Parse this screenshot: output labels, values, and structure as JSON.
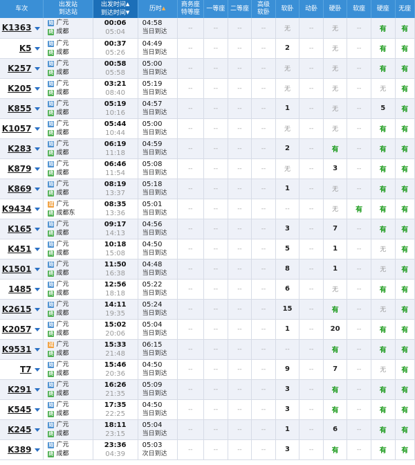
{
  "headers": {
    "train": "车次",
    "stations_top": "出发站",
    "stations_bottom": "到达站",
    "times_top": "出发时间",
    "times_bottom": "到达时间",
    "duration": "历时",
    "business_top": "商务座",
    "business_bottom": "特等座",
    "first": "一等座",
    "second": "二等座",
    "advsleeper_top": "高级",
    "advsleeper_bottom": "软卧",
    "softsleeper": "软卧",
    "emu": "动卧",
    "hardsleeper": "硬卧",
    "softseat": "软座",
    "hardseat": "硬座",
    "noseat": "无座",
    "sort_arrow": "▲"
  },
  "trains": [
    {
      "no": "K1363",
      "from": "广元",
      "to": "成都",
      "from_type": "始",
      "to_type": "终",
      "dep": "00:06",
      "arr": "05:04",
      "dur": "04:58",
      "day": "当日到达",
      "seats": [
        "--",
        "--",
        "--",
        "--",
        "无",
        "--",
        "无",
        "--",
        "有",
        "有"
      ]
    },
    {
      "no": "K5",
      "from": "广元",
      "to": "成都",
      "from_type": "始",
      "to_type": "终",
      "dep": "00:37",
      "arr": "05:26",
      "dur": "04:49",
      "day": "当日到达",
      "seats": [
        "--",
        "--",
        "--",
        "--",
        "2",
        "--",
        "无",
        "--",
        "有",
        "有"
      ]
    },
    {
      "no": "K257",
      "from": "广元",
      "to": "成都",
      "from_type": "始",
      "to_type": "终",
      "dep": "00:58",
      "arr": "05:58",
      "dur": "05:00",
      "day": "当日到达",
      "seats": [
        "--",
        "--",
        "--",
        "--",
        "无",
        "--",
        "无",
        "--",
        "有",
        "有"
      ]
    },
    {
      "no": "K205",
      "from": "广元",
      "to": "成都",
      "from_type": "始",
      "to_type": "终",
      "dep": "03:21",
      "arr": "08:40",
      "dur": "05:19",
      "day": "当日到达",
      "seats": [
        "--",
        "--",
        "--",
        "--",
        "无",
        "--",
        "无",
        "--",
        "无",
        "有"
      ]
    },
    {
      "no": "K855",
      "from": "广元",
      "to": "成都",
      "from_type": "始",
      "to_type": "终",
      "dep": "05:19",
      "arr": "10:16",
      "dur": "04:57",
      "day": "当日到达",
      "seats": [
        "--",
        "--",
        "--",
        "--",
        "1",
        "--",
        "无",
        "--",
        "5",
        "有"
      ]
    },
    {
      "no": "K1057",
      "from": "广元",
      "to": "成都",
      "from_type": "始",
      "to_type": "终",
      "dep": "05:44",
      "arr": "10:44",
      "dur": "05:00",
      "day": "当日到达",
      "seats": [
        "--",
        "--",
        "--",
        "--",
        "无",
        "--",
        "无",
        "--",
        "有",
        "有"
      ]
    },
    {
      "no": "K283",
      "from": "广元",
      "to": "成都",
      "from_type": "始",
      "to_type": "终",
      "dep": "06:19",
      "arr": "11:18",
      "dur": "04:59",
      "day": "当日到达",
      "seats": [
        "--",
        "--",
        "--",
        "--",
        "2",
        "--",
        "有",
        "--",
        "有",
        "有"
      ]
    },
    {
      "no": "K879",
      "from": "广元",
      "to": "成都",
      "from_type": "始",
      "to_type": "终",
      "dep": "06:46",
      "arr": "11:54",
      "dur": "05:08",
      "day": "当日到达",
      "seats": [
        "--",
        "--",
        "--",
        "--",
        "无",
        "--",
        "3",
        "--",
        "有",
        "有"
      ]
    },
    {
      "no": "K869",
      "from": "广元",
      "to": "成都",
      "from_type": "始",
      "to_type": "终",
      "dep": "08:19",
      "arr": "13:37",
      "dur": "05:18",
      "day": "当日到达",
      "seats": [
        "--",
        "--",
        "--",
        "--",
        "1",
        "--",
        "无",
        "--",
        "有",
        "有"
      ]
    },
    {
      "no": "K9434",
      "from": "广元",
      "to": "成都东",
      "from_type": "过",
      "to_type": "终",
      "dep": "08:35",
      "arr": "13:36",
      "dur": "05:01",
      "day": "当日到达",
      "seats": [
        "--",
        "--",
        "--",
        "--",
        "--",
        "--",
        "无",
        "有",
        "有",
        "有"
      ]
    },
    {
      "no": "K165",
      "from": "广元",
      "to": "成都",
      "from_type": "始",
      "to_type": "终",
      "dep": "09:17",
      "arr": "14:13",
      "dur": "04:56",
      "day": "当日到达",
      "seats": [
        "--",
        "--",
        "--",
        "--",
        "3",
        "--",
        "7",
        "--",
        "有",
        "有"
      ]
    },
    {
      "no": "K451",
      "from": "广元",
      "to": "成都",
      "from_type": "始",
      "to_type": "终",
      "dep": "10:18",
      "arr": "15:08",
      "dur": "04:50",
      "day": "当日到达",
      "seats": [
        "--",
        "--",
        "--",
        "--",
        "5",
        "--",
        "1",
        "--",
        "无",
        "有"
      ]
    },
    {
      "no": "K1501",
      "from": "广元",
      "to": "成都",
      "from_type": "始",
      "to_type": "终",
      "dep": "11:50",
      "arr": "16:38",
      "dur": "04:48",
      "day": "当日到达",
      "seats": [
        "--",
        "--",
        "--",
        "--",
        "8",
        "--",
        "1",
        "--",
        "无",
        "有"
      ]
    },
    {
      "no": "1485",
      "from": "广元",
      "to": "成都",
      "from_type": "始",
      "to_type": "终",
      "dep": "12:56",
      "arr": "18:18",
      "dur": "05:22",
      "day": "当日到达",
      "seats": [
        "--",
        "--",
        "--",
        "--",
        "6",
        "--",
        "无",
        "--",
        "有",
        "有"
      ]
    },
    {
      "no": "K2615",
      "from": "广元",
      "to": "成都",
      "from_type": "始",
      "to_type": "终",
      "dep": "14:11",
      "arr": "19:35",
      "dur": "05:24",
      "day": "当日到达",
      "seats": [
        "--",
        "--",
        "--",
        "--",
        "15",
        "--",
        "有",
        "--",
        "无",
        "有"
      ]
    },
    {
      "no": "K2057",
      "from": "广元",
      "to": "成都",
      "from_type": "始",
      "to_type": "终",
      "dep": "15:02",
      "arr": "20:06",
      "dur": "05:04",
      "day": "当日到达",
      "seats": [
        "--",
        "--",
        "--",
        "--",
        "1",
        "--",
        "20",
        "--",
        "有",
        "有"
      ]
    },
    {
      "no": "K9531",
      "from": "广元",
      "to": "成都",
      "from_type": "过",
      "to_type": "终",
      "dep": "15:33",
      "arr": "21:48",
      "dur": "06:15",
      "day": "当日到达",
      "seats": [
        "--",
        "--",
        "--",
        "--",
        "--",
        "--",
        "有",
        "--",
        "有",
        "有"
      ]
    },
    {
      "no": "T7",
      "from": "广元",
      "to": "成都",
      "from_type": "始",
      "to_type": "终",
      "dep": "15:46",
      "arr": "20:36",
      "dur": "04:50",
      "day": "当日到达",
      "seats": [
        "--",
        "--",
        "--",
        "--",
        "9",
        "--",
        "7",
        "--",
        "无",
        "有"
      ]
    },
    {
      "no": "K291",
      "from": "广元",
      "to": "成都",
      "from_type": "始",
      "to_type": "终",
      "dep": "16:26",
      "arr": "21:35",
      "dur": "05:09",
      "day": "当日到达",
      "seats": [
        "--",
        "--",
        "--",
        "--",
        "3",
        "--",
        "有",
        "--",
        "有",
        "有"
      ]
    },
    {
      "no": "K545",
      "from": "广元",
      "to": "成都",
      "from_type": "始",
      "to_type": "终",
      "dep": "17:35",
      "arr": "22:25",
      "dur": "04:50",
      "day": "当日到达",
      "seats": [
        "--",
        "--",
        "--",
        "--",
        "3",
        "--",
        "有",
        "--",
        "有",
        "有"
      ]
    },
    {
      "no": "K245",
      "from": "广元",
      "to": "成都",
      "from_type": "始",
      "to_type": "终",
      "dep": "18:11",
      "arr": "23:15",
      "dur": "05:04",
      "day": "当日到达",
      "seats": [
        "--",
        "--",
        "--",
        "--",
        "1",
        "--",
        "6",
        "--",
        "有",
        "有"
      ]
    },
    {
      "no": "K389",
      "from": "广元",
      "to": "成都",
      "from_type": "始",
      "to_type": "终",
      "dep": "23:36",
      "arr": "04:39",
      "dur": "05:03",
      "day": "次日到达",
      "seats": [
        "--",
        "--",
        "--",
        "--",
        "3",
        "--",
        "有",
        "--",
        "有",
        "有"
      ]
    }
  ],
  "colors": {
    "header": "#3a8fd6",
    "header_sorted": "#1c6fb8",
    "available": "#1a9a1a",
    "row_alt": "#eef1f8"
  }
}
